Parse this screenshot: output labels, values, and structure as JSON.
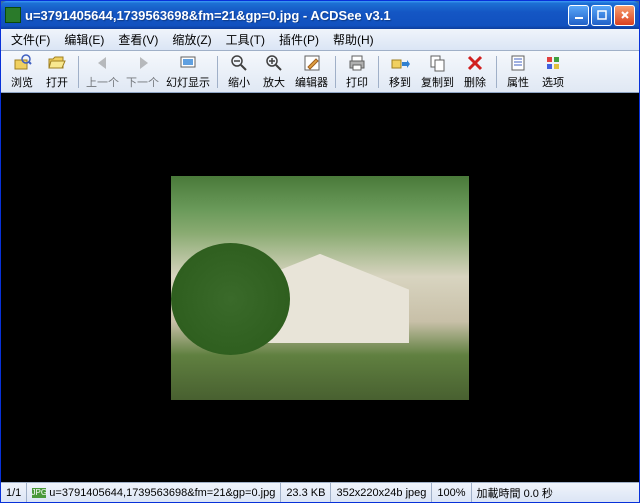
{
  "title": "u=3791405644,1739563698&fm=21&gp=0.jpg - ACDSee v3.1",
  "menu": {
    "file": "文件(F)",
    "edit": "编辑(E)",
    "view": "查看(V)",
    "zoom": "缩放(Z)",
    "tools": "工具(T)",
    "plugins": "插件(P)",
    "help": "帮助(H)"
  },
  "toolbar": {
    "browse": "浏览",
    "open": "打开",
    "prev": "上一个",
    "next": "下一个",
    "slideshow": "幻灯显示",
    "zoomout": "缩小",
    "zoomin": "放大",
    "editor": "编辑器",
    "print": "打印",
    "moveto": "移到",
    "copyto": "复制到",
    "delete": "删除",
    "properties": "属性",
    "options": "选项"
  },
  "status": {
    "position": "1/1",
    "filetype_badge": "JPG",
    "filename": "u=3791405644,1739563698&fm=21&gp=0.jpg",
    "filesize": "23.3 KB",
    "dimensions": "352x220x24b jpeg",
    "zoom": "100%",
    "loadtime": "加載時間 0.0 秒"
  }
}
